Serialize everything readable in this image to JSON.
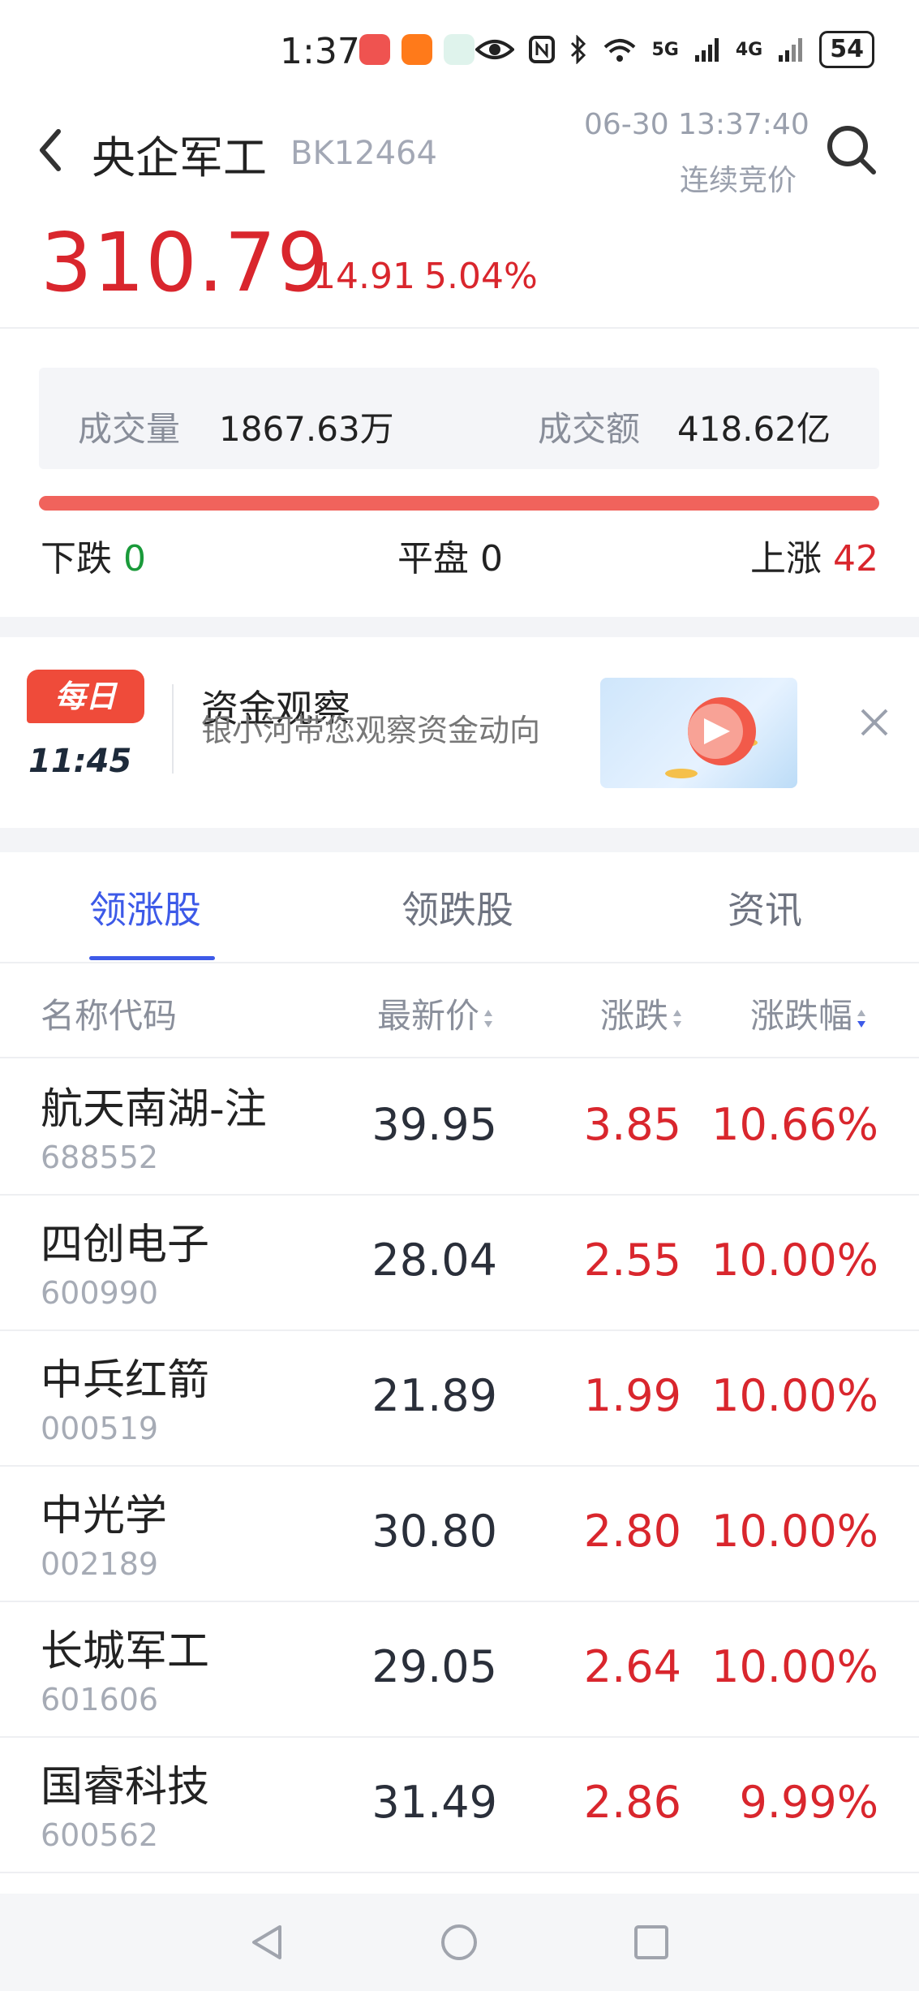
{
  "status_bar": {
    "time": "1:37",
    "network_5g": "5G",
    "network_4g": "4G",
    "battery": "54",
    "icons": [
      "book-app-icon",
      "kuaishou-app-icon",
      "vr-app-icon",
      "eye-icon",
      "nfc-icon",
      "bluetooth-icon",
      "wifi-icon",
      "signal-icon"
    ]
  },
  "header": {
    "title": "央企军工",
    "code": "BK12464",
    "datetime": "06-30 13:37:40",
    "status": "连续竞价"
  },
  "quote": {
    "price": "310.79",
    "change": "14.91",
    "change_pct": "5.04%"
  },
  "volume": {
    "vol_label": "成交量",
    "vol_value": "1867.63万",
    "amt_label": "成交额",
    "amt_value": "418.62亿"
  },
  "breadth": {
    "down_label": "下跌",
    "down_value": "0",
    "flat_label": "平盘",
    "flat_value": "0",
    "up_label": "上涨",
    "up_value": "42"
  },
  "banner": {
    "badge": "每日",
    "time": "11:45",
    "title": "资金观察",
    "subtitle": "银小河带您观察资金动向"
  },
  "tabs": [
    {
      "label": "领涨股",
      "active": true
    },
    {
      "label": "领跌股",
      "active": false
    },
    {
      "label": "资讯",
      "active": false
    }
  ],
  "table": {
    "headers": {
      "name": "名称代码",
      "price": "最新价",
      "change": "涨跌",
      "pct": "涨跌幅"
    },
    "rows": [
      {
        "name": "航天南湖-注",
        "code": "688552",
        "price": "39.95",
        "change": "3.85",
        "pct": "10.66%"
      },
      {
        "name": "四创电子",
        "code": "600990",
        "price": "28.04",
        "change": "2.55",
        "pct": "10.00%"
      },
      {
        "name": "中兵红箭",
        "code": "000519",
        "price": "21.89",
        "change": "1.99",
        "pct": "10.00%"
      },
      {
        "name": "中光学",
        "code": "002189",
        "price": "30.80",
        "change": "2.80",
        "pct": "10.00%"
      },
      {
        "name": "长城军工",
        "code": "601606",
        "price": "29.05",
        "change": "2.64",
        "pct": "10.00%"
      },
      {
        "name": "国睿科技",
        "code": "600562",
        "price": "31.49",
        "change": "2.86",
        "pct": "9.99%"
      }
    ]
  },
  "colors": {
    "up": "#d9262d",
    "down": "#1a9a3a",
    "accent": "#3d5ae8"
  }
}
